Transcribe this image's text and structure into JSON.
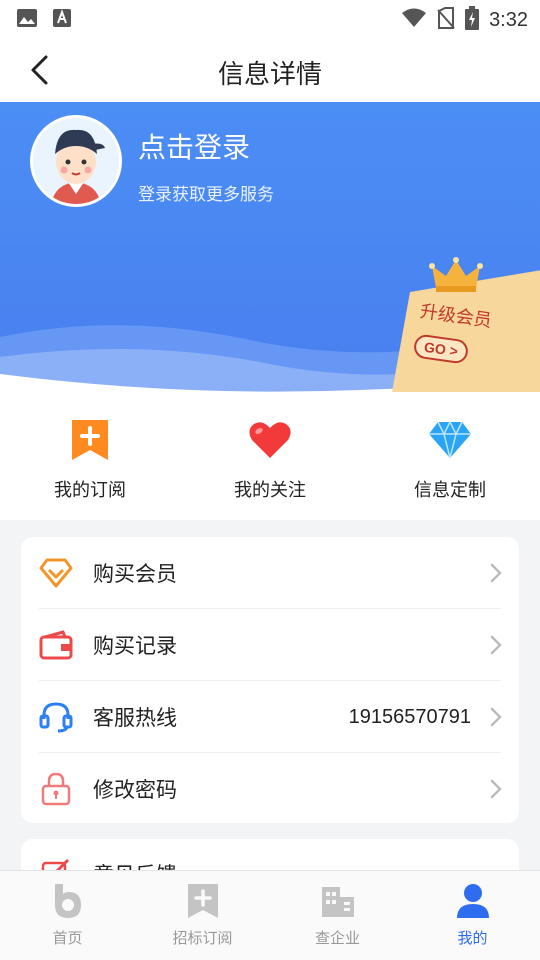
{
  "status_bar": {
    "time": "3:32"
  },
  "nav": {
    "title": "信息详情"
  },
  "profile": {
    "login_title": "点击登录",
    "login_subtitle": "登录获取更多服务"
  },
  "vip": {
    "label": "升级会员",
    "go": "GO >"
  },
  "quick_actions": [
    {
      "label": "我的订阅",
      "icon": "bookmark-plus-icon",
      "color": "#ff8a1f"
    },
    {
      "label": "我的关注",
      "icon": "heart-icon",
      "color": "#f23a3a"
    },
    {
      "label": "信息定制",
      "icon": "diamond-icon",
      "color": "#2aa4f4"
    }
  ],
  "menu": [
    {
      "label": "购买会员",
      "icon": "vip-diamond-icon",
      "value": ""
    },
    {
      "label": "购买记录",
      "icon": "wallet-icon",
      "value": ""
    },
    {
      "label": "客服热线",
      "icon": "headset-icon",
      "value": "19156570791"
    },
    {
      "label": "修改密码",
      "icon": "lock-icon",
      "value": ""
    }
  ],
  "menu_partial": {
    "label": "意见反馈"
  },
  "tabs": [
    {
      "label": "首页",
      "icon": "home-b-icon",
      "active": false
    },
    {
      "label": "招标订阅",
      "icon": "bookmark-tab-icon",
      "active": false
    },
    {
      "label": "查企业",
      "icon": "building-icon",
      "active": false
    },
    {
      "label": "我的",
      "icon": "user-icon",
      "active": true
    }
  ],
  "colors": {
    "accent": "#2f6df0",
    "hero_blue": "#4a86f2",
    "inactive_gray": "#999999"
  }
}
